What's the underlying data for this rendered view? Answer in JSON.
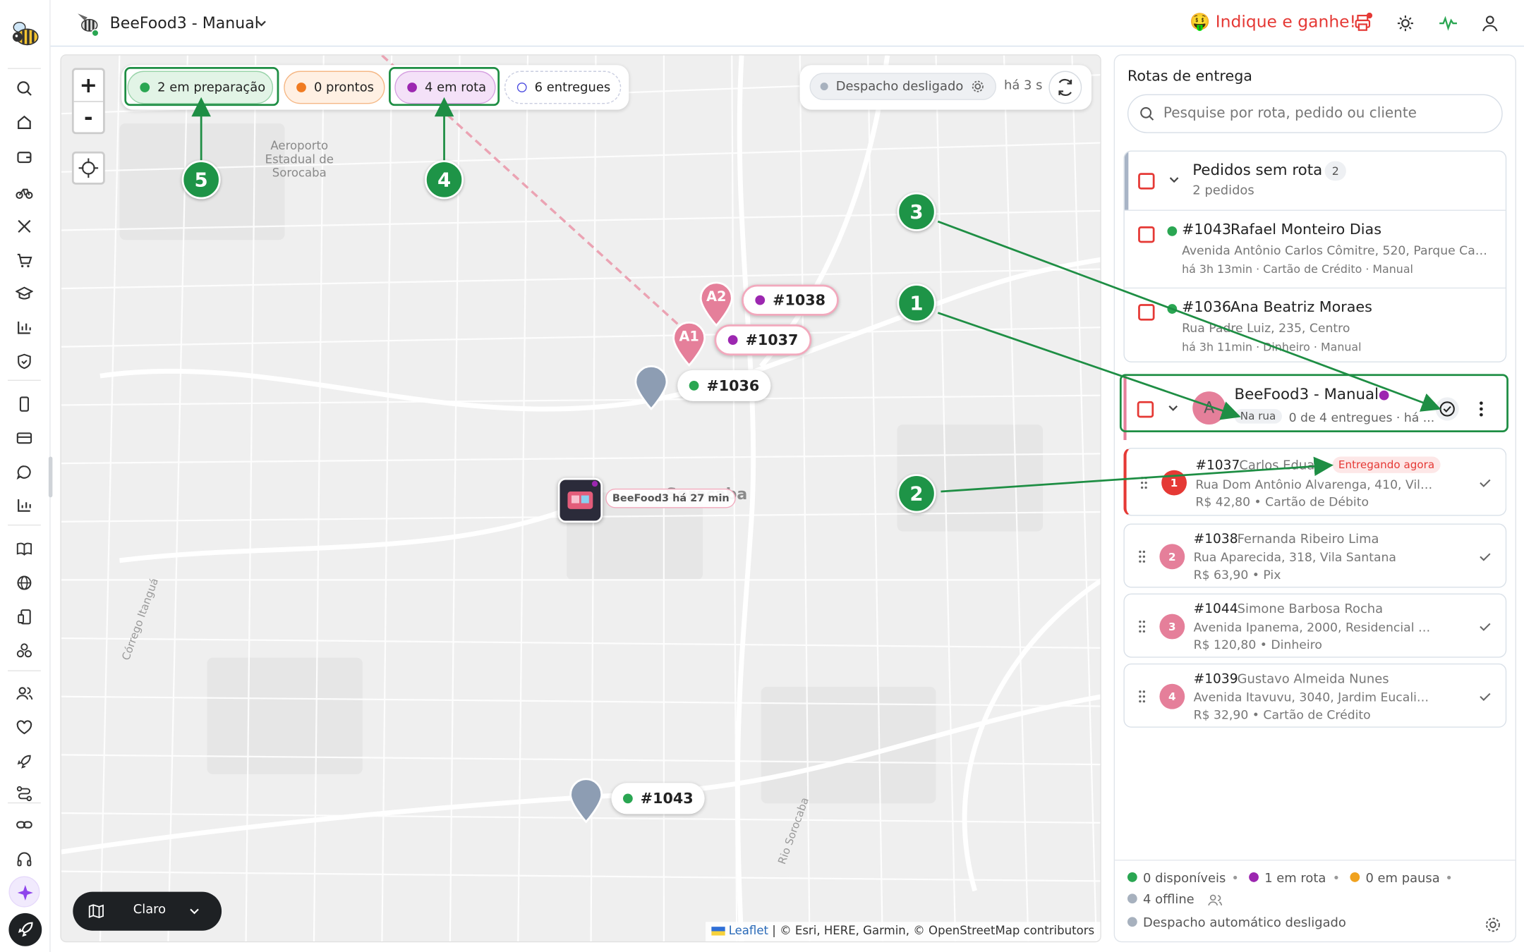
{
  "header": {
    "store_name": "BeeFood3 - Manual",
    "refer_text": "🤑 Indique e ganhe!"
  },
  "map": {
    "status_chips": [
      {
        "label": "2 em preparação",
        "color": "#2aa652"
      },
      {
        "label": "0 prontos",
        "color": "#f07b21"
      },
      {
        "label": "4 em rota",
        "color": "#9c27b0"
      },
      {
        "label": "6 entregues",
        "color": "#4a4ae0"
      }
    ],
    "zoom_in": "+",
    "zoom_out": "-",
    "dispatch_label": "Despacho desligado",
    "dispatch_time": "há 3 s",
    "map_labels": {
      "airport": "Aeroporto Estadual de Sorocaba",
      "city": "Sorocaba",
      "stream1": "Córrego Itanguá",
      "stream2": "Rio Sorocaba"
    },
    "markers": [
      {
        "pin": "A2",
        "tag": "#1038"
      },
      {
        "pin": "A1",
        "tag": "#1037"
      },
      {
        "pin": "",
        "tag": "#1036"
      },
      {
        "pin": "",
        "tag": "#1043"
      }
    ],
    "driver_label": "BeeFood3 há 27 min",
    "map_style": "Claro",
    "attribution_link": "Leaflet",
    "attribution_text": "| © Esri, HERE, Garmin, © OpenStreetMap contributors",
    "annotations": [
      "1",
      "2",
      "3",
      "4",
      "5"
    ]
  },
  "panel": {
    "title": "Rotas de entrega",
    "search_placeholder": "Pesquise por rota, pedido ou cliente",
    "unrouted": {
      "title": "Pedidos sem rota",
      "count": "2",
      "subtitle": "2 pedidos"
    },
    "unrouted_orders": [
      {
        "number": "#1043",
        "name": "Rafael Monteiro Dias",
        "address": "Avenida Antônio Carlos Cômitre, 520, Parque Cam...",
        "meta": "há 3h 13min · Cartão de Crédito · Manual"
      },
      {
        "number": "#1036",
        "name": "Ana Beatriz Moraes",
        "address": "Rua Padre Luiz, 235, Centro",
        "meta": "há 3h 11min · Dinheiro · Manual"
      }
    ],
    "route": {
      "avatar": "A",
      "name": "BeeFood3 - Manual",
      "status": "Na rua",
      "progress": "0 de 4 entregues · há ..."
    },
    "stops": [
      {
        "index": "1",
        "number": "#1037",
        "name": "Carlos Eduar...",
        "badge": "Entregando agora",
        "address": "Rua Dom Antônio Alvarenga, 410, Vila S...",
        "meta": "R$ 42,80 • Cartão de Débito"
      },
      {
        "index": "2",
        "number": "#1038",
        "name": "Fernanda Ribeiro Lima",
        "badge": "",
        "address": "Rua Aparecida, 318, Vila Santana",
        "meta": "R$ 63,90 • Pix"
      },
      {
        "index": "3",
        "number": "#1044",
        "name": "Simone Barbosa Rocha",
        "badge": "",
        "address": "Avenida Ipanema, 2000, Residencial Res...",
        "meta": "R$ 120,80 • Dinheiro"
      },
      {
        "index": "4",
        "number": "#1039",
        "name": "Gustavo Almeida Nunes",
        "badge": "",
        "address": "Avenida Itavuvu, 3040, Jardim Eucaliptos",
        "meta": "R$ 32,90 • Cartão de Crédito"
      }
    ],
    "footer": {
      "available": "0 disponíveis",
      "on_route": "1 em rota",
      "paused": "0 em pausa",
      "offline": "4 offline",
      "auto_dispatch": "Despacho automático desligado"
    }
  },
  "colors": {
    "accent_green": "#1e8e44",
    "refer_red": "#e53935",
    "route_pink": "#e57f9a",
    "purple": "#9c27b0",
    "pin_gray": "#8d9db3"
  }
}
